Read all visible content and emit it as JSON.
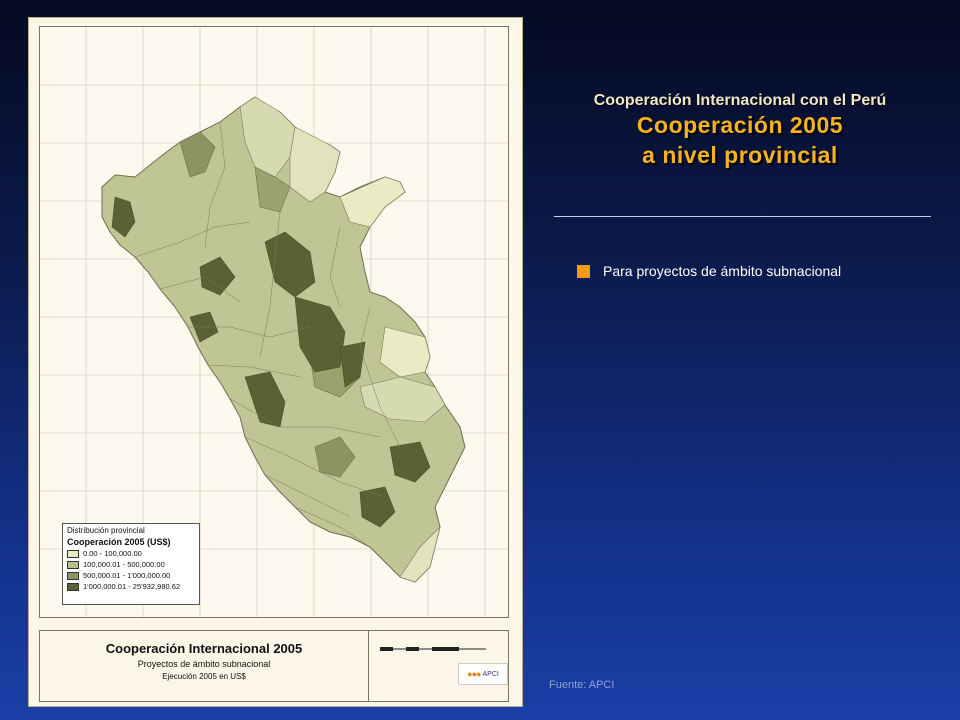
{
  "heading": {
    "line1": "Cooperación Internacional con el Perú",
    "line2": "Cooperación 2005",
    "line3": "a nivel provincial"
  },
  "note": {
    "text": "Para proyectos de ámbito subnacional",
    "bullet_color": "#f29b15"
  },
  "source": "Fuente: APCI",
  "map": {
    "legend": {
      "title": "Distribución provincial",
      "subtitle": "Cooperación 2005 (US$)",
      "items": [
        {
          "label": "0.00 - 100,000.00",
          "color": "#e8ebc4"
        },
        {
          "label": "100,000.01 - 500,000.00",
          "color": "#b9bf8a"
        },
        {
          "label": "500,000.01 - 1'000,000.00",
          "color": "#8c9562"
        },
        {
          "label": "1'000,000.01 - 25'932,980.62",
          "color": "#5b6134"
        }
      ]
    },
    "title_block": {
      "title": "Cooperación Internacional 2005",
      "subtitle": "Proyectos de ámbito subnacional",
      "note": "Ejecución 2005 en US$"
    },
    "logo_text": "APCI"
  }
}
